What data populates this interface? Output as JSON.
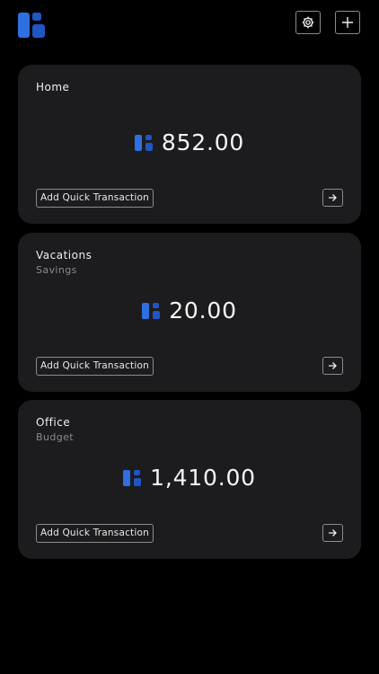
{
  "header": {
    "logo_icon": "app-logo-icon",
    "settings_icon": "gear-icon",
    "add_icon": "plus-icon"
  },
  "accounts": [
    {
      "title": "Home",
      "subtitle": "",
      "balance": "852.00",
      "quick_action_label": "Add Quick Transaction",
      "open_icon": "arrow-right-icon"
    },
    {
      "title": "Vacations",
      "subtitle": "Savings",
      "balance": "20.00",
      "quick_action_label": "Add Quick Transaction",
      "open_icon": "arrow-right-icon"
    },
    {
      "title": "Office",
      "subtitle": "Budget",
      "balance": "1,410.00",
      "quick_action_label": "Add Quick Transaction",
      "open_icon": "arrow-right-icon"
    }
  ],
  "colors": {
    "accent": "#2f6fe0",
    "accent_dark": "#1f56c4",
    "card_background": "#1c1c1e",
    "page_background": "#000000"
  }
}
